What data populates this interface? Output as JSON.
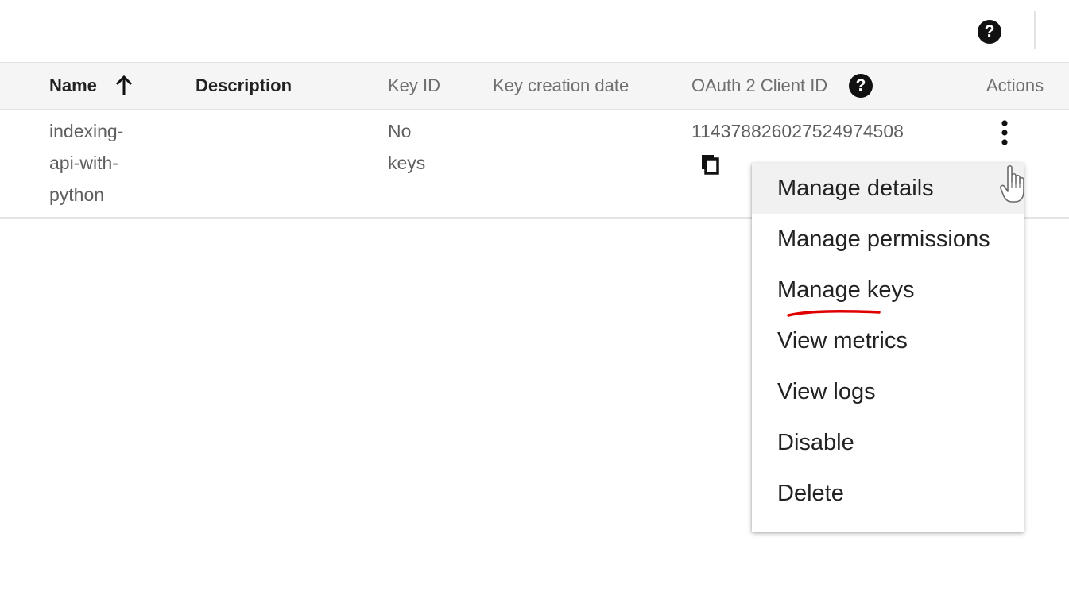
{
  "topbar": {
    "help_icon_glyph": "?"
  },
  "table": {
    "columns": {
      "name": "Name",
      "description": "Description",
      "key_id": "Key ID",
      "key_creation_date": "Key creation date",
      "oauth_client_id": "OAuth 2 Client ID",
      "actions": "Actions"
    },
    "help_glyph": "?",
    "rows": [
      {
        "name_lines": [
          "indexing-",
          "api-with-",
          "python"
        ],
        "key_id_lines": [
          "No",
          "keys"
        ],
        "oauth_client_id": "114378826027524974508"
      }
    ]
  },
  "actions_menu": {
    "items": [
      "Manage details",
      "Manage permissions",
      "Manage keys",
      "View metrics",
      "View logs",
      "Disable",
      "Delete"
    ],
    "highlighted_item": "Manage details",
    "annotated_item": "Manage keys",
    "annotation_color": "#e00000"
  },
  "icons": {
    "sort": "arrow-up-icon",
    "copy": "copy-icon",
    "more": "more-vert-icon",
    "help": "help-icon",
    "cursor": "hand-pointer-cursor-icon"
  }
}
